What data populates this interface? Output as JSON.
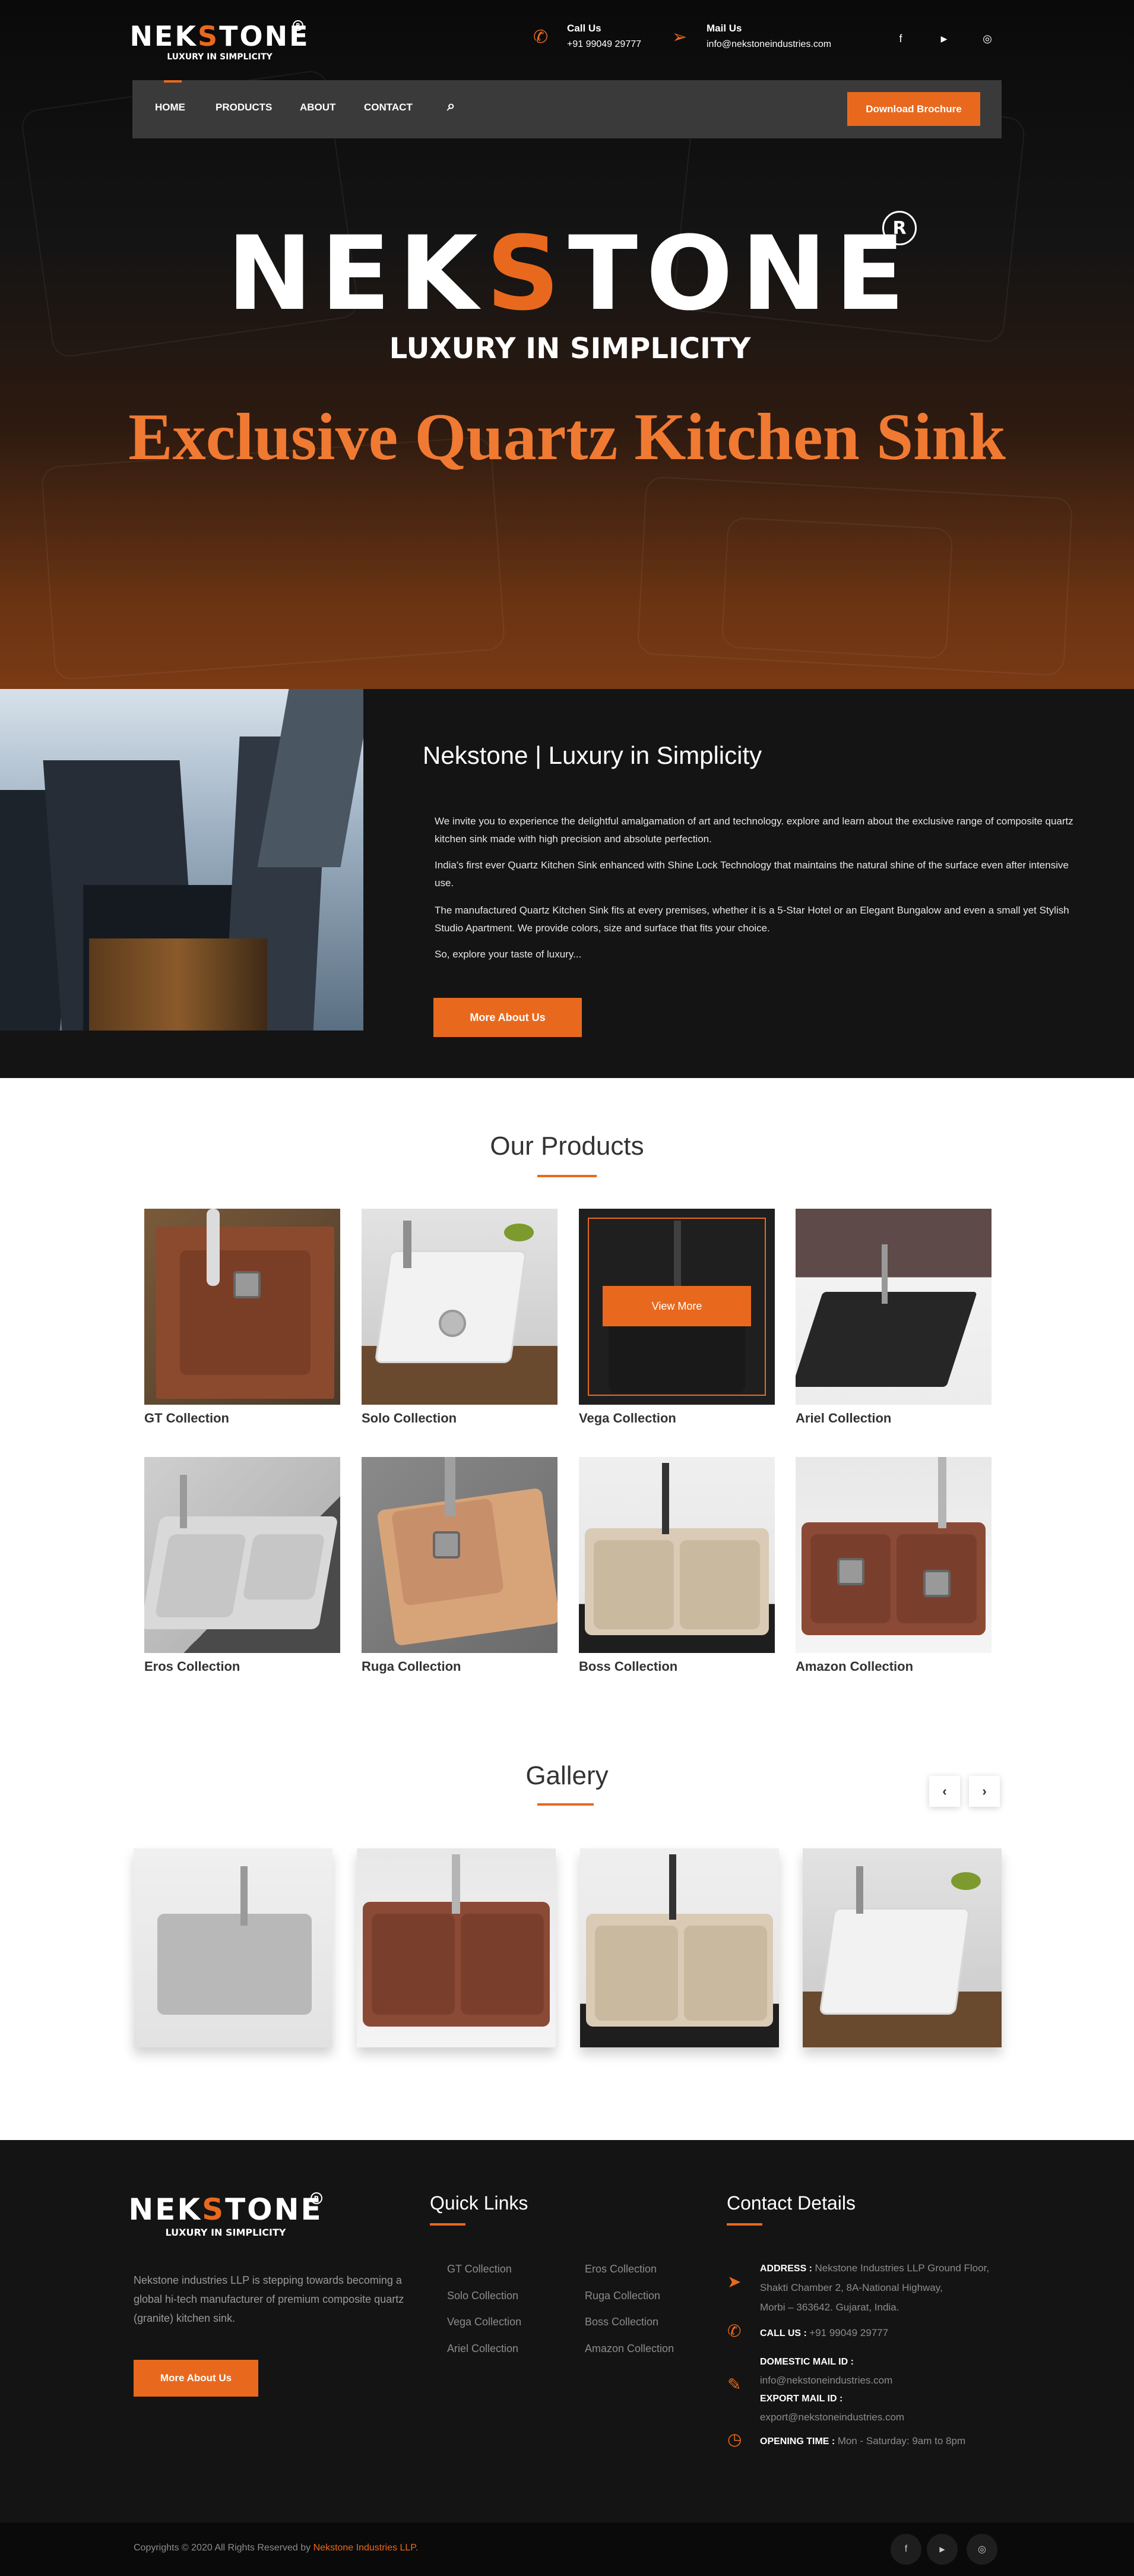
{
  "brand": {
    "name_a": "NEK",
    "name_o": "S",
    "name_b": "TONE",
    "reg": "R",
    "tagline": "LUXURY IN SIMPLICITY"
  },
  "topbar": {
    "call_label": "Call Us",
    "call_value": "+91 99049 29777",
    "mail_label": "Mail Us",
    "mail_value": "info@nekstoneindustries.com",
    "social": [
      "f",
      "▶",
      "◎"
    ]
  },
  "nav": {
    "items": [
      "HOME",
      "PRODUCTS",
      "ABOUT",
      "CONTACT"
    ],
    "brochure": "Download Brochure"
  },
  "hero": {
    "heading": "Exclusive Quartz Kitchen Sink"
  },
  "about": {
    "title": "Nekstone | Luxury in Simplicity",
    "p1": "We invite you to experience the delightful amalgamation of art and technology. explore and learn about the exclusive range of composite quartz kitchen sink made with high precision and absolute perfection.",
    "p2": "India's first ever Quartz Kitchen Sink enhanced with Shine Lock Technology that maintains the natural shine of the surface even after intensive use.",
    "p3": "The manufactured Quartz Kitchen Sink fits at every premises, whether it is a 5-Star Hotel or an Elegant Bungalow and even a small yet Stylish Studio Apartment. We provide colors, size and surface that fits your choice.",
    "p4": "So, explore your taste of luxury...",
    "button": "More About Us"
  },
  "products": {
    "title": "Our Products",
    "view_more": "View More",
    "items": [
      "GT Collection",
      "Solo Collection",
      "Vega Collection",
      "Ariel Collection",
      "Eros Collection",
      "Ruga Collection",
      "Boss Collection",
      "Amazon Collection"
    ]
  },
  "gallery": {
    "title": "Gallery",
    "prev": "‹",
    "next": "›"
  },
  "footer": {
    "about_text": "Nekstone industries LLP is stepping towards becoming a global hi-tech manufacturer of premium composite quartz (granite) kitchen sink.",
    "button": "More About Us",
    "quick_links_title": "Quick Links",
    "links_col1": [
      "GT Collection",
      "Solo Collection",
      "Vega Collection",
      "Ariel Collection"
    ],
    "links_col2": [
      "Eros Collection",
      "Ruga Collection",
      "Boss Collection",
      "Amazon Collection"
    ],
    "contact_title": "Contact Details",
    "address_label": "ADDRESS :",
    "address_line1": "Nekstone Industries LLP Ground Floor,",
    "address_line2": "Shakti Chamber 2, 8A-National Highway,",
    "address_line3": "Morbi – 363642. Gujarat, India.",
    "call_label": "CALL US :",
    "call_value": "+91 99049 29777",
    "domestic_label": "DOMESTIC MAIL ID :",
    "domestic_value": "info@nekstoneindustries.com",
    "export_label": "EXPORT MAIL ID :",
    "export_value": "export@nekstoneindustries.com",
    "opening_label": "OPENING TIME :",
    "opening_value": "Mon - Saturday: 9am to 8pm",
    "copyright": "Copyrights © 2020 All Rights Reserved by",
    "copyright_company": "Nekstone Industries LLP.",
    "social": [
      "f",
      "▶",
      "◎"
    ]
  },
  "colors": {
    "accent": "#e8691e",
    "dark": "#141414"
  },
  "icons": [
    "phone-icon",
    "send-icon",
    "search-icon",
    "facebook-icon",
    "youtube-icon",
    "instagram-icon",
    "location-icon",
    "mail-icon",
    "clock-icon",
    "chevron-left-icon",
    "chevron-right-icon"
  ]
}
